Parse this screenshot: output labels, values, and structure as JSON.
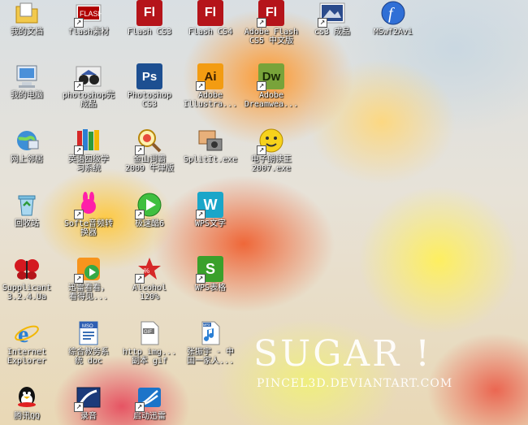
{
  "desktop": {
    "icons": [
      {
        "label": "我的文档",
        "icon": "my-documents-icon"
      },
      {
        "label": "flash素材",
        "icon": "flash-assets-icon"
      },
      {
        "label": "Flash CS3",
        "icon": "flash-cs3-icon"
      },
      {
        "label": "Flash CS4",
        "icon": "flash-cs4-icon"
      },
      {
        "label": "Adobe Flash\nCS5 中文版",
        "icon": "flash-cs5-icon"
      },
      {
        "label": "cs3 成品",
        "icon": "cs3-output-icon"
      },
      {
        "label": "MSwf2Avi",
        "icon": "mswf2avi-icon"
      },
      {
        "label": "我的电脑",
        "icon": "my-computer-icon"
      },
      {
        "label": "photoshop完\n成品",
        "icon": "photoshop-output-icon"
      },
      {
        "label": "Photoshop\nCS3",
        "icon": "photoshop-icon"
      },
      {
        "label": "Adobe\nIllustra...",
        "icon": "illustrator-icon"
      },
      {
        "label": "Adobe\nDreamwea...",
        "icon": "dreamweaver-icon"
      },
      {
        "label": "网上邻居",
        "icon": "network-icon"
      },
      {
        "label": "英语四级学\n习系统",
        "icon": "english-books-icon"
      },
      {
        "label": "金山词霸\n2009 牛津版",
        "icon": "dictionary-icon"
      },
      {
        "label": "SplitIt.exe",
        "icon": "splitit-icon"
      },
      {
        "label": "电子朗读王\n2007.exe",
        "icon": "reader-icon"
      },
      {
        "label": "回收站",
        "icon": "recycle-bin-icon"
      },
      {
        "label": "Softe音频转\n换器",
        "icon": "audio-converter-icon"
      },
      {
        "label": "极速酷6",
        "icon": "ku6-icon"
      },
      {
        "label": "WPS文字",
        "icon": "wps-writer-icon"
      },
      {
        "label": "Supplicant\n3.2.4.Ua",
        "icon": "butterfly-icon"
      },
      {
        "label": "迅雷看看，\n看得见...",
        "icon": "xunlei-kankan-icon"
      },
      {
        "label": "Alcohol\n120%",
        "icon": "alcohol-icon"
      },
      {
        "label": "WPS表格",
        "icon": "wps-sheet-icon"
      },
      {
        "label": "Internet\nExplorer",
        "icon": "ie-icon"
      },
      {
        "label": "综合教务系\n统 doc",
        "icon": "doc-icon"
      },
      {
        "label": "http_img...\n副本 gif",
        "icon": "gif-icon"
      },
      {
        "label": "张振宇 - 中\n国一家人...",
        "icon": "mp3-icon"
      },
      {
        "label": "腾讯QQ",
        "icon": "qq-icon"
      },
      {
        "label": "录音",
        "icon": "recorder-icon"
      },
      {
        "label": "启动迅雷",
        "icon": "xunlei-icon"
      }
    ]
  },
  "wallpaper": {
    "title": "SUGAR !",
    "credit": "PINCEL3D.DEVIANTART.COM"
  },
  "colors": {
    "flash_red": "#b5141a",
    "photoshop_blue": "#1d4f91",
    "illustrator_orange": "#f39c12",
    "dreamweaver_green": "#78a33a",
    "wps_teal": "#1aa6c9",
    "wps_green": "#3aa02b"
  }
}
